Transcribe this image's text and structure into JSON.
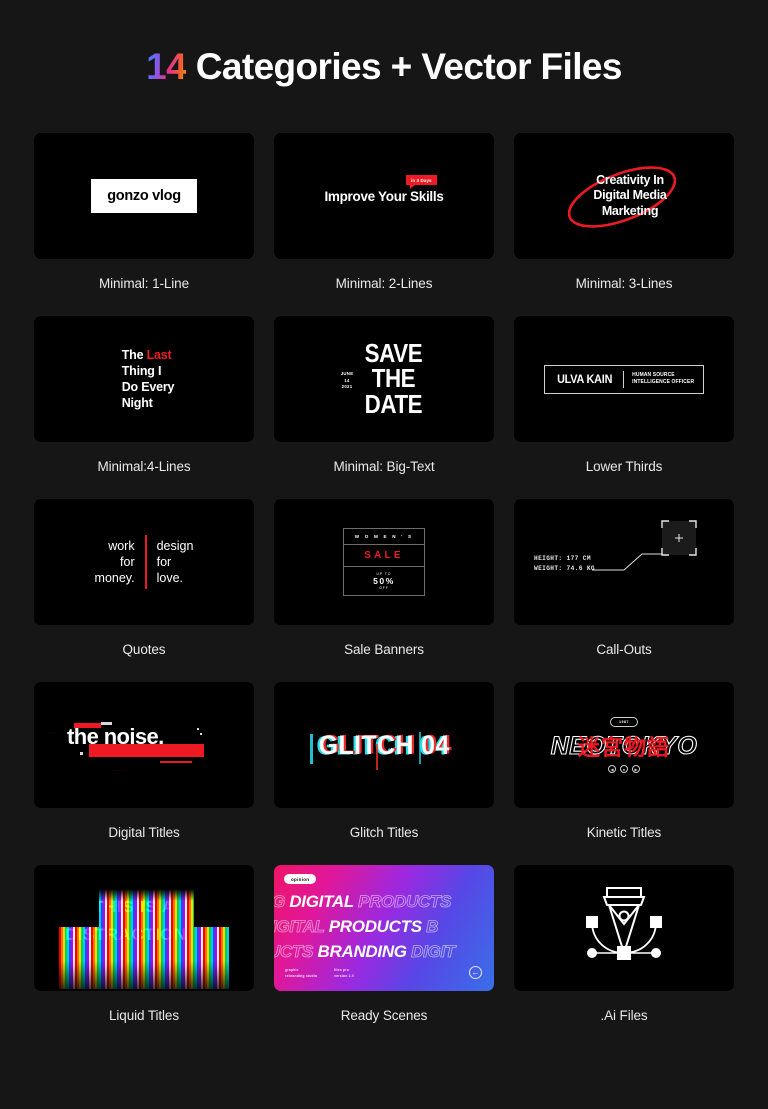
{
  "heading": {
    "number": "14",
    "rest": " Categories + Vector Files"
  },
  "cards": [
    {
      "caption": "Minimal: 1-Line",
      "preview": {
        "kind": "gonzo",
        "text": "gonzo vlog"
      }
    },
    {
      "caption": "Minimal: 2-Lines",
      "preview": {
        "kind": "improve",
        "text": "Improve Your Skills",
        "tag": "in 3 Days"
      }
    },
    {
      "caption": "Minimal: 3-Lines",
      "preview": {
        "kind": "creativity",
        "line1": "Creativity In",
        "line2": "Digital Media",
        "line3": "Marketing",
        "accent": "#ee1a23"
      }
    },
    {
      "caption": "Minimal:4-Lines",
      "preview": {
        "kind": "last",
        "l1a": "The ",
        "l1b": "Last",
        "l2": "Thing I",
        "l3": "Do Every",
        "l4": "Night",
        "accent": "#ef1a22"
      }
    },
    {
      "caption": "Minimal: Big-Text",
      "preview": {
        "kind": "save",
        "d1": "JUNE",
        "d2": "14",
        "d3": "2021",
        "b1": "SAVE",
        "b2": "THE",
        "b3": "DATE"
      }
    },
    {
      "caption": "Lower Thirds",
      "preview": {
        "kind": "lower",
        "name": "ULVA KAIN",
        "role1": "HUMAN SOURCE",
        "role2": "INTELLIGENCE OFFICER"
      }
    },
    {
      "caption": "Quotes",
      "preview": {
        "kind": "quote",
        "left1": "work",
        "left2": "for",
        "left3": "money.",
        "right1": "design",
        "right2": "for",
        "right3": "love.",
        "accent": "#ee1a23"
      }
    },
    {
      "caption": "Sale Banners",
      "preview": {
        "kind": "sale",
        "womens": "W O M E N ' S",
        "sale": "SALE",
        "upto": "UP TO",
        "percent": "50%",
        "off": "OFF",
        "accent": "#ee1a23"
      }
    },
    {
      "caption": "Call-Outs",
      "preview": {
        "kind": "callout",
        "height": "HEIGHT: 177 CM",
        "weight": "WEIGHT: 74.6 KG"
      }
    },
    {
      "caption": "Digital Titles",
      "preview": {
        "kind": "noise",
        "text": "the noise.",
        "dots1": "....",
        "dots2": ".......",
        "accent": "#ee1a23"
      }
    },
    {
      "caption": "Glitch Titles",
      "preview": {
        "kind": "glitch",
        "text": "GLITCH 04",
        "cyan": "#24e0ef",
        "red": "#ee2b2b"
      }
    },
    {
      "caption": "Kinetic Titles",
      "preview": {
        "kind": "kinetic",
        "badge": "1987",
        "text": "NEOTOKYO",
        "kanji": "迷宮物語",
        "i1": "◀",
        "i2": "●",
        "i3": "▶",
        "accent": "#ee1a23"
      }
    },
    {
      "caption": "Liquid Titles",
      "preview": {
        "kind": "liquid",
        "line1": "THIS IS A",
        "line2": "DISTRACTION"
      }
    },
    {
      "caption": "Ready Scenes",
      "preview": {
        "kind": "ready",
        "badge": "opinion",
        "row1a": "NG ",
        "row1b": "DIGITAL ",
        "row1c": "PRODUCTS",
        "row2a": "DIGITAL ",
        "row2b": "PRODUCTS ",
        "row2c": "B",
        "row3a": "UCTS ",
        "row3b": "BRANDING ",
        "row3c": "DIGIT",
        "meta1a": "graphic",
        "meta1b": "rebranding studio",
        "meta2a": "files pro",
        "meta2b": "version 2.0",
        "arrow": "←",
        "gradient_from": "#ef1566",
        "gradient_to": "#3a6fe8"
      }
    },
    {
      "caption": ".Ai Files",
      "preview": {
        "kind": "ai",
        "icon": "pen-tool-icon"
      }
    }
  ],
  "theme": {
    "background": "#161616",
    "thumb_background": "#000000",
    "caption_color": "#e9e9e9"
  }
}
